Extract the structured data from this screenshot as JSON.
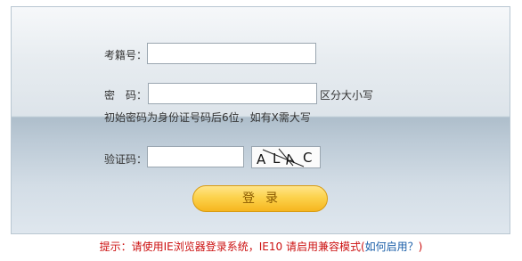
{
  "form": {
    "exam_no_label": "考籍号：",
    "exam_no_value": "",
    "password_label": "密　码：",
    "password_value": "",
    "case_note": "区分大小写",
    "initial_password_note": "初始密码为身份证号码后6位，如有X需大写",
    "captcha_label": "验证码：",
    "captcha_value": "",
    "captcha_text": "ALAC",
    "login_button": "登录"
  },
  "footer": {
    "tip_text": "提示：请使用IE浏览器登录系统，IE10 请启用兼容模式(",
    "tip_link": "如何启用？",
    "tip_close": ")"
  }
}
